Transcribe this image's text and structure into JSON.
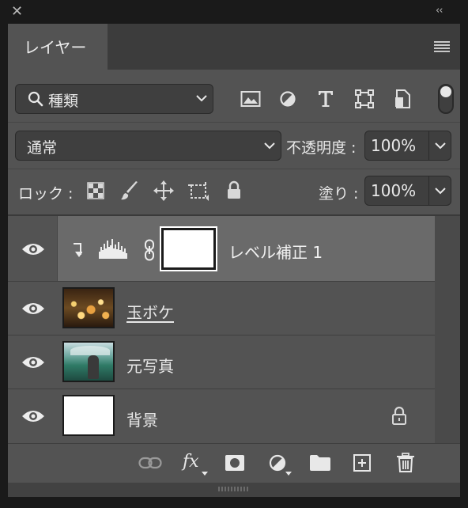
{
  "panel": {
    "tab_label": "レイヤー",
    "close_glyph": "✕",
    "collapse_glyph": "‹‹"
  },
  "filter": {
    "kind_label": "種類",
    "icons": [
      "image-filter-icon",
      "adjustment-filter-icon",
      "type-filter-icon",
      "shape-filter-icon",
      "smart-object-filter-icon"
    ]
  },
  "blend": {
    "mode": "通常",
    "opacity_label": "不透明度 :",
    "opacity_value": "100%"
  },
  "lock": {
    "label": "ロック :",
    "fill_label": "塗り :",
    "fill_value": "100%"
  },
  "layers": [
    {
      "name": "レベル補正 1",
      "type": "adjustment",
      "selected": true,
      "clipped": true
    },
    {
      "name": "玉ボケ",
      "type": "image",
      "underlined": true
    },
    {
      "name": "元写真",
      "type": "image"
    },
    {
      "name": "背景",
      "type": "background",
      "locked": true
    }
  ],
  "footer": {
    "fx_label": "fx"
  },
  "colors": {
    "panel": "#535353",
    "selected_row": "#6a6a6a",
    "field": "#3f3f3f",
    "chrome": "#1a1a1a"
  }
}
